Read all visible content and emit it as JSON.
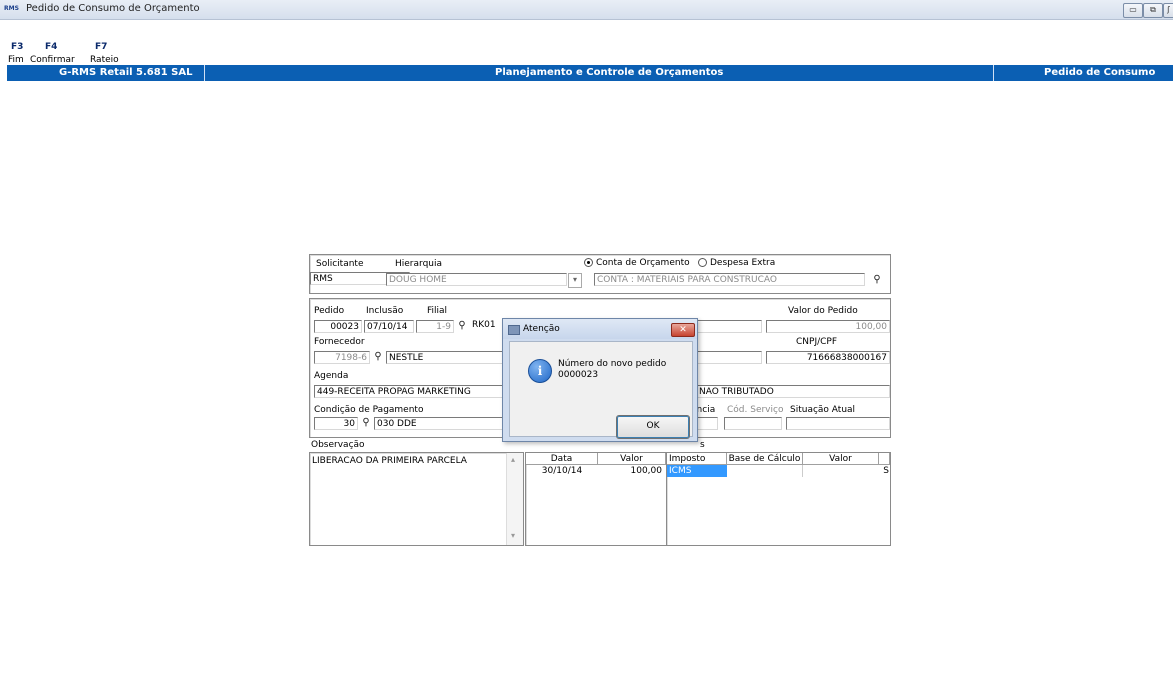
{
  "window": {
    "app_badge": "RMS",
    "title": "Pedido de Consumo de Orçamento",
    "minimize": "▭",
    "restore": "⧉",
    "close": "ʃ"
  },
  "toolbar": {
    "items": [
      {
        "key": "F3",
        "label": "Fim"
      },
      {
        "key": "F4",
        "label": "Confirmar"
      },
      {
        "key": "F7",
        "label": "Rateio"
      }
    ]
  },
  "banner": {
    "left": "G-RMS Retail 5.681 SAL",
    "center": "Planejamento e Controle de Orçamentos",
    "right": "Pedido de Consumo"
  },
  "top_panel": {
    "solicitante_label": "Solicitante",
    "solicitante_value": "RMS",
    "hierarquia_label": "Hierarquia",
    "hierarquia_value": "DOUG HOME",
    "dropdown_arrow": "▾",
    "radio_conta_label": "Conta de Orçamento",
    "radio_despesa_label": "Despesa Extra",
    "conta_value": "CONTA : MATERIAIS PARA CONSTRUCAO"
  },
  "main_panel": {
    "pedido_label": "Pedido",
    "pedido_value": "00023",
    "inclusao_label": "Inclusão",
    "inclusao_value": "07/10/14",
    "filial_label": "Filial",
    "filial_value": "1-9",
    "filial_name": "RK01",
    "valor_pedido_label": "Valor do Pedido",
    "valor_pedido_value": "100,00",
    "fornecedor_label": "Fornecedor",
    "fornecedor_code": "7198-6",
    "fornecedor_name": "NESTLE",
    "cnpj_label": "CNPJ/CPF",
    "cnpj_value": "71666838000167",
    "agenda_label": "Agenda",
    "agenda_value": "449-RECEITA PROPAG MARKETING",
    "tributacao_value": "NAO TRIBUTADO",
    "condicao_label": "Condição de Pagamento",
    "condicao_code": "30",
    "condicao_value": "030 DDE",
    "agencia_label": "ência",
    "cod_servico_label": "Cód. Serviço",
    "situacao_label": "Situação Atual"
  },
  "observacao": {
    "label": "Observação",
    "text": "LIBERACAO DA PRIMEIRA PARCELA",
    "scroll_up": "▴",
    "scroll_down": "▾"
  },
  "parcelas": {
    "headers": [
      "Data",
      "Valor"
    ],
    "rows": [
      [
        "30/10/14",
        "100,00"
      ]
    ]
  },
  "impostos": {
    "label_fragment": "s",
    "headers": [
      "Imposto",
      "Base de Cálculo",
      "Valor"
    ],
    "rows": [
      [
        "ICMS",
        "",
        "",
        "S"
      ]
    ]
  },
  "dialog": {
    "title": "Atenção",
    "close": "✕",
    "message_line1": "Número do novo pedido",
    "message_line2": "0000023",
    "info_glyph": "i",
    "ok_label": "OK"
  },
  "colors": {
    "banner_blue": "#0b5fb3",
    "selection_blue": "#3399ff",
    "info_icon": "#1f67c7"
  }
}
